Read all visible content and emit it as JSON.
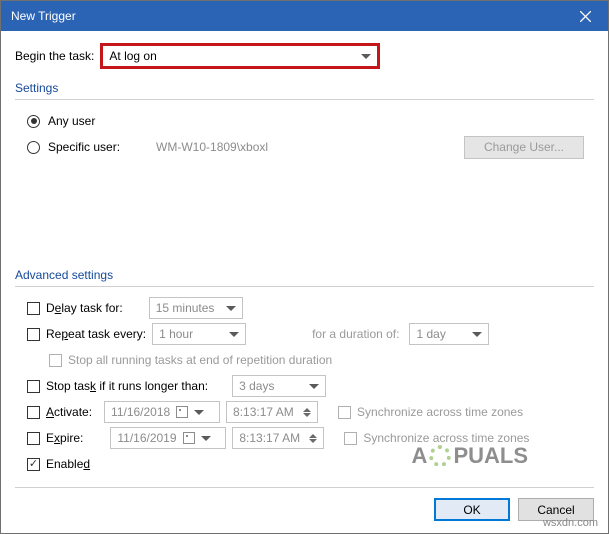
{
  "window": {
    "title": "New Trigger"
  },
  "begin": {
    "label": "Begin the task:",
    "selected": "At log on"
  },
  "settings": {
    "group_label": "Settings",
    "any_user": "Any user",
    "specific_user": "Specific user:",
    "user_value": "WM-W10-1809\\xboxl",
    "change_user": "Change User..."
  },
  "advanced": {
    "group_label": "Advanced settings",
    "delay_label_pre": "D",
    "delay_label_u": "e",
    "delay_label_post": "lay task for:",
    "delay_value": "15 minutes",
    "repeat_label_pre": "Re",
    "repeat_label_u": "p",
    "repeat_label_post": "eat task every:",
    "repeat_value": "1 hour",
    "duration_label": "for a duration of:",
    "duration_value": "1 day",
    "stop_running_label": "Stop all running tasks at end of repetition duration",
    "stop_longer_label_pre": "Stop tas",
    "stop_longer_label_u": "k",
    "stop_longer_label_post": " if it runs longer than:",
    "stop_longer_value": "3 days",
    "activate_pre": "",
    "activate_u": "A",
    "activate_post": "ctivate:",
    "activate_date": "11/16/2018",
    "activate_time": "8:13:17 AM",
    "expire_pre": "E",
    "expire_u": "x",
    "expire_post": "pire:",
    "expire_date": "11/16/2019",
    "expire_time": "8:13:17 AM",
    "sync_label": "Synchronize across time zones",
    "enabled_pre": "Enable",
    "enabled_u": "d",
    "enabled_post": ""
  },
  "buttons": {
    "ok": "OK",
    "cancel": "Cancel"
  },
  "watermark": {
    "pre": "A",
    "post": "PUALS"
  },
  "domain": "wsxdn.com"
}
